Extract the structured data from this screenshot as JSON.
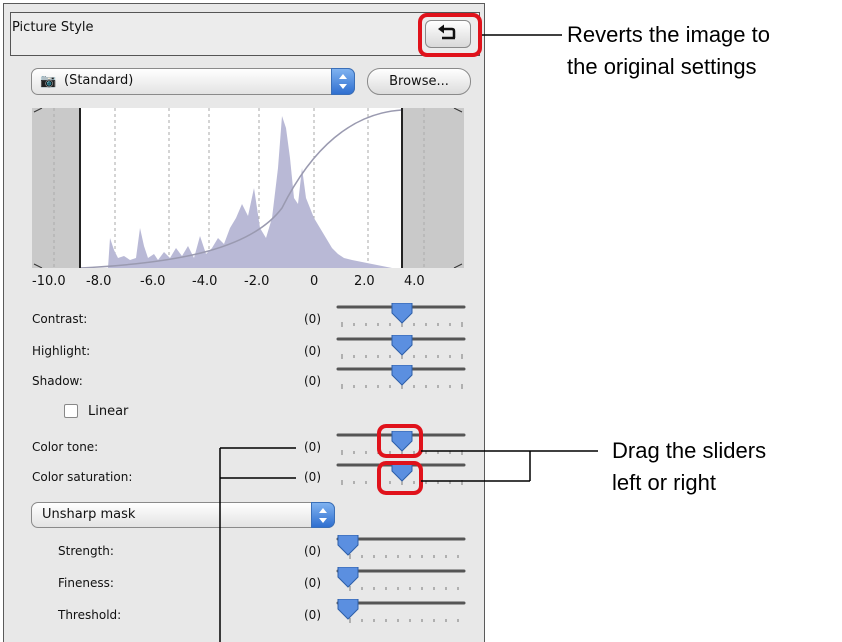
{
  "panel": {
    "title": "Picture Style",
    "style_select": "(Standard)",
    "browse_label": "Browse...",
    "histogram_axis": [
      "-10.0",
      "-8.0",
      "-6.0",
      "-4.0",
      "-2.0",
      "0",
      "2.0",
      "4.0"
    ],
    "sliders": [
      {
        "label": "Contrast:",
        "value": "(0)"
      },
      {
        "label": "Highlight:",
        "value": "(0)"
      },
      {
        "label": "Shadow:",
        "value": "(0)"
      },
      {
        "label": "Color tone:",
        "value": "(0)"
      },
      {
        "label": "Color saturation:",
        "value": "(0)"
      }
    ],
    "linear_label": "Linear",
    "sharpen_select": "Unsharp mask",
    "sharpen_sliders": [
      {
        "label": "Strength:",
        "value": "(0)"
      },
      {
        "label": "Fineness:",
        "value": "(0)"
      },
      {
        "label": "Threshold:",
        "value": "(0)"
      }
    ]
  },
  "annotations": {
    "revert_line1": "Reverts the image to",
    "revert_line2": "the original settings",
    "drag_line1": "Drag the sliders",
    "drag_line2": "left or right"
  },
  "colors": {
    "highlight": "#e0121b",
    "histogram_fill": "#b9b9d6",
    "curve": "#9a9ab0",
    "thumb": "#5b8fe0"
  }
}
